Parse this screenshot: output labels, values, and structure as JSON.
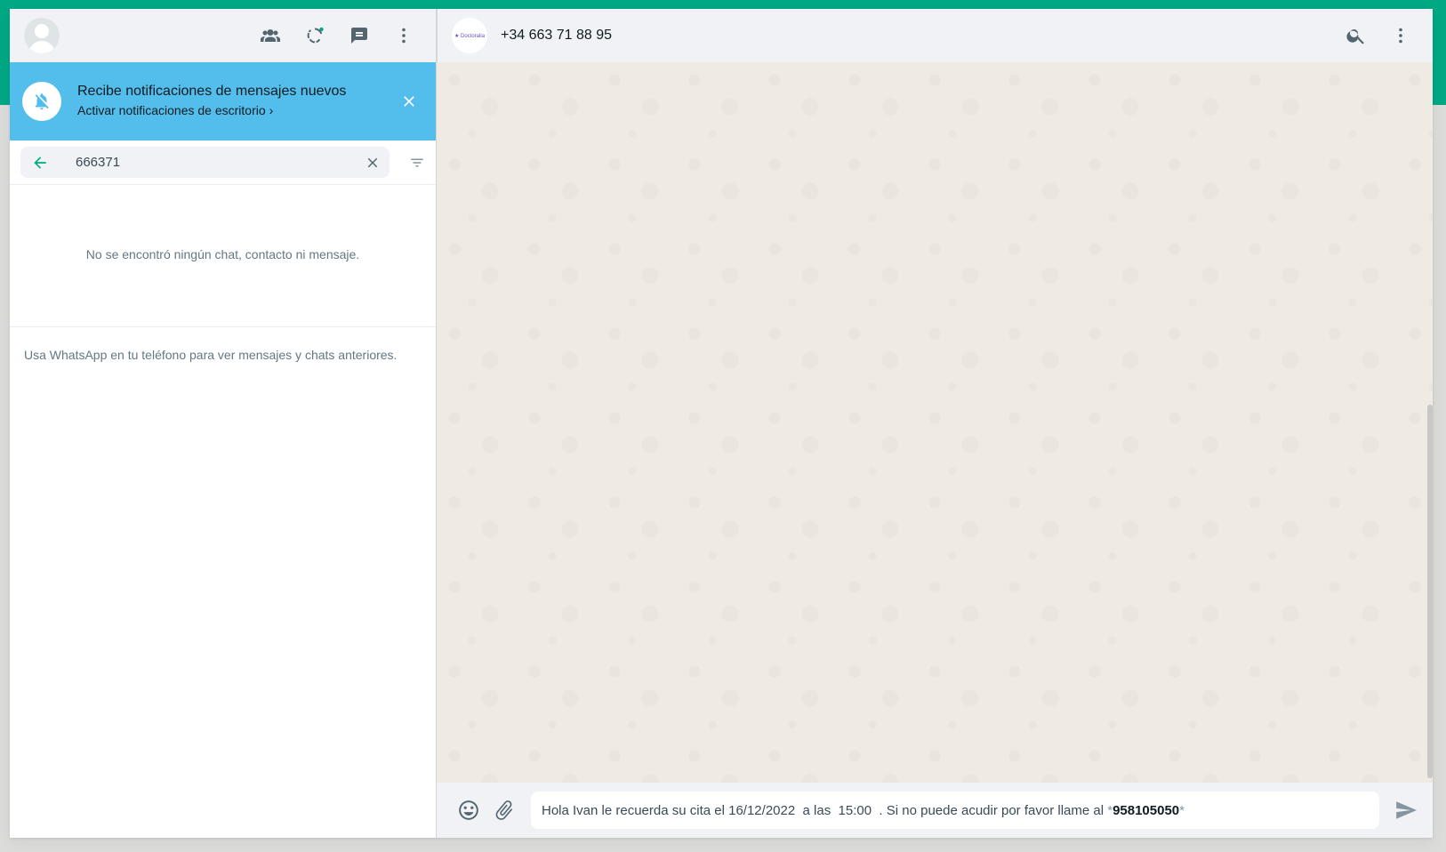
{
  "left": {
    "header": {
      "icons": [
        "communities-icon",
        "status-icon",
        "new-chat-icon",
        "menu-icon"
      ]
    },
    "notification": {
      "title": "Recibe notificaciones de mensajes nuevos",
      "link": "Activar notificaciones de escritorio",
      "link_chevron": "›"
    },
    "search": {
      "value": "666371",
      "placeholder": ""
    },
    "no_results": "No se encontró ningún chat, contacto ni mensaje.",
    "hint": "Usa WhatsApp en tu teléfono para ver mensajes y chats anteriores."
  },
  "chat": {
    "contact_name": "+34 663 71 88 95",
    "contact_logo_text": "★ Doctoralia",
    "composer": {
      "text_prefix": "Hola Ivan le recuerda su cita el 16/12/2022  a las  15:00  . Si no puede acudir por favor llame al ",
      "star_open": "*",
      "bold_number": "958105050",
      "star_close": "*"
    }
  },
  "colors": {
    "accent": "#00a884",
    "banner": "#53bdeb",
    "chat_bg": "#efeae2"
  }
}
